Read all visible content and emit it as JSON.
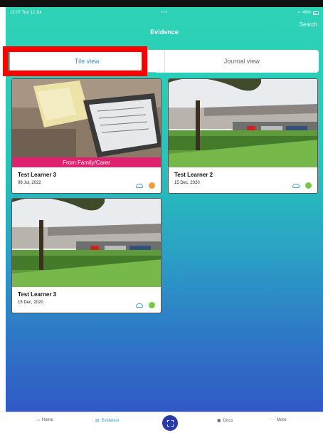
{
  "status_bar": {
    "time_date": "12:07  Tue 12 Jul",
    "center": "•••",
    "battery": "46%"
  },
  "nav": {
    "title": "Evidence",
    "search": "Search"
  },
  "segments": {
    "tile": "Tile view",
    "journal": "Journal view"
  },
  "cards": [
    {
      "name": "Test Learner 3",
      "date": "08 Jul, 2022",
      "banner": "From Family/Carer",
      "dot_color": "#f39a3c"
    },
    {
      "name": "Test Learner 2",
      "date": "15 Dec, 2020",
      "dot_color": "#7ac943"
    },
    {
      "name": "Test Learner 3",
      "date": "15 Dec, 2020",
      "dot_color": "#7ac943"
    }
  ],
  "tabs": {
    "home": "Home",
    "evidence": "Evidence",
    "docs": "Docs",
    "more": "More"
  }
}
